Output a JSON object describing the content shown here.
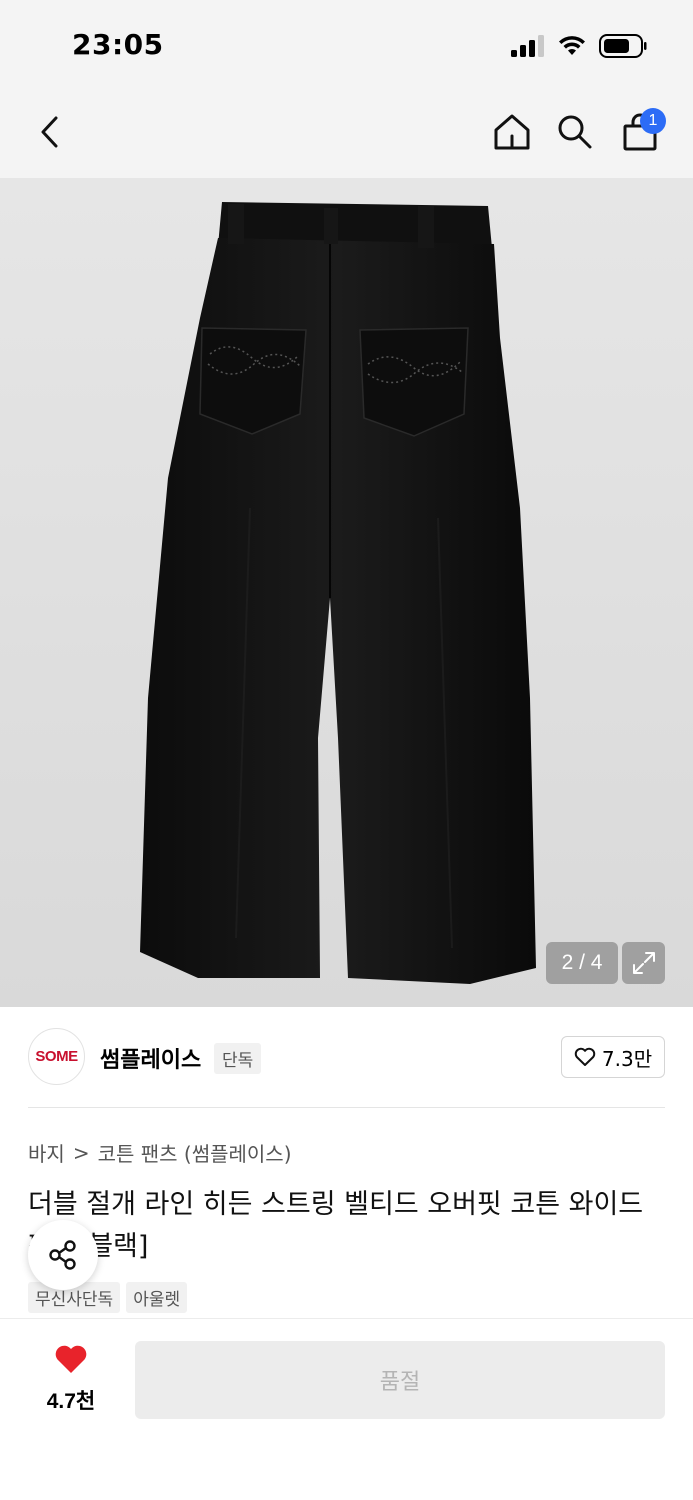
{
  "status_bar": {
    "time": "23:05"
  },
  "nav": {
    "cart_count": "1"
  },
  "gallery": {
    "counter": "2 / 4"
  },
  "brand": {
    "logo_text": "SOME",
    "name": "썸플레이스",
    "tag": "단독",
    "likes": "7.3만"
  },
  "breadcrumb": {
    "category": "바지",
    "separator": ">",
    "subcategory": "코튼 팬츠 (썸플레이스)"
  },
  "product": {
    "title": "더블 절개 라인 히든 스트링 벨티드 오버핏 코튼 와이드 팬츠[블랙]",
    "tags": [
      "무신사단독",
      "아울렛"
    ]
  },
  "bottom": {
    "like_count": "4.7천",
    "buy_button": "품절"
  },
  "colors": {
    "accent_like": "#e8232b",
    "badge": "#2c6cf6",
    "brand_logo": "#c8102e"
  }
}
